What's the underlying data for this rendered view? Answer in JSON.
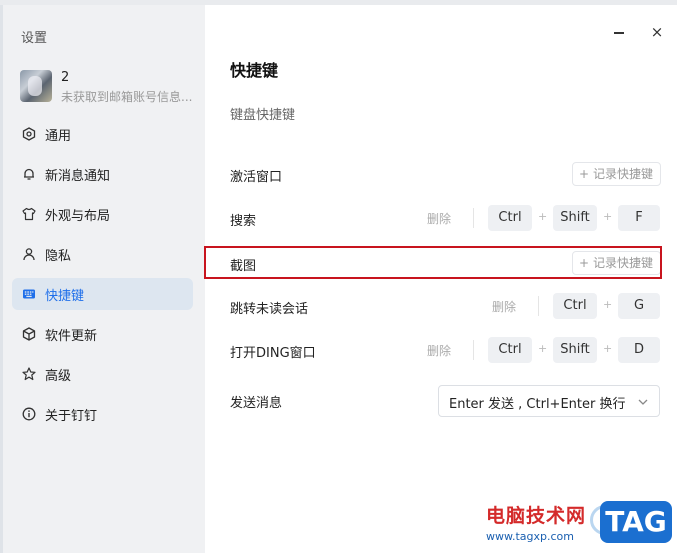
{
  "sidebar": {
    "title": "设置",
    "profile": {
      "name": "2",
      "subtitle": "未获取到邮箱账号信息..."
    },
    "items": [
      {
        "label": "通用",
        "icon": "general-icon",
        "active": false
      },
      {
        "label": "新消息通知",
        "icon": "bell-icon",
        "active": false
      },
      {
        "label": "外观与布局",
        "icon": "shirt-icon",
        "active": false
      },
      {
        "label": "隐私",
        "icon": "user-icon",
        "active": false
      },
      {
        "label": "快捷键",
        "icon": "keyboard-icon",
        "active": true
      },
      {
        "label": "软件更新",
        "icon": "cube-icon",
        "active": false
      },
      {
        "label": "高级",
        "icon": "star-icon",
        "active": false
      },
      {
        "label": "关于钉钉",
        "icon": "info-icon",
        "active": false
      }
    ]
  },
  "window": {
    "minimize": "minimize-icon",
    "close": "×"
  },
  "main": {
    "title": "快捷键",
    "section": "键盘快捷键",
    "record_label": "记录快捷键",
    "delete_label": "删除",
    "rows": [
      {
        "label": "激活窗口"
      },
      {
        "label": "搜索",
        "keys": [
          "Ctrl",
          "Shift",
          "F"
        ]
      },
      {
        "label": "截图"
      },
      {
        "label": "跳转未读会话",
        "keys": [
          "Ctrl",
          "G"
        ]
      },
      {
        "label": "打开DING窗口",
        "keys": [
          "Ctrl",
          "Shift",
          "D"
        ]
      },
      {
        "label": "发送消息"
      }
    ],
    "send_select": {
      "value": "Enter 发送 , Ctrl+Enter 换行"
    }
  },
  "watermark": {
    "text": "电脑技术网",
    "url": "www.tagxp.com",
    "tag": "TAG"
  },
  "colors": {
    "accent": "#1f6fea",
    "highlight": "#c8141e",
    "sidebar_bg": "#f0f1f3",
    "active_bg": "#dde6f0"
  }
}
